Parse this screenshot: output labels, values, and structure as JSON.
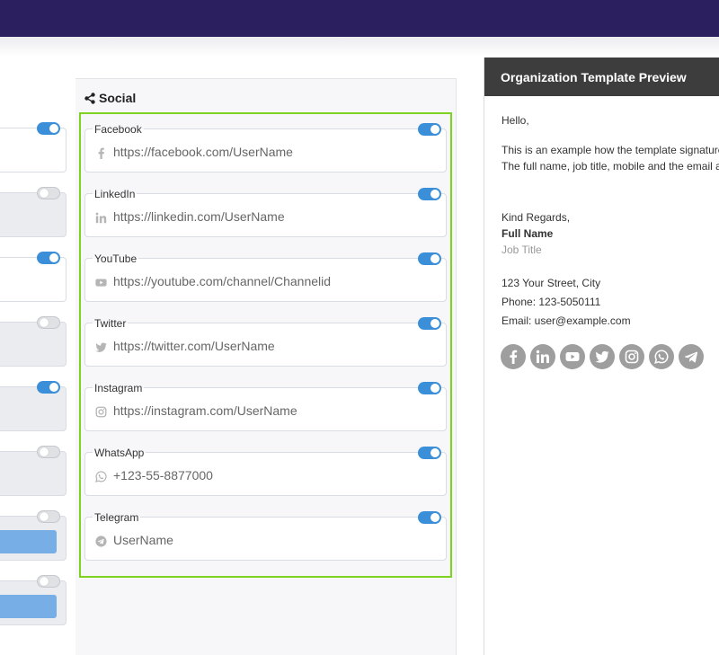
{
  "social": {
    "heading": "Social",
    "fields": [
      {
        "label": "Facebook",
        "value": "https://facebook.com/UserName",
        "icon": "facebook-icon",
        "enabled": true
      },
      {
        "label": "LinkedIn",
        "value": "https://linkedin.com/UserName",
        "icon": "linkedin-icon",
        "enabled": true
      },
      {
        "label": "YouTube",
        "value": "https://youtube.com/channel/Channelid",
        "icon": "youtube-icon",
        "enabled": true
      },
      {
        "label": "Twitter",
        "value": "https://twitter.com/UserName",
        "icon": "twitter-icon",
        "enabled": true
      },
      {
        "label": "Instagram",
        "value": "https://instagram.com/UserName",
        "icon": "instagram-icon",
        "enabled": true
      },
      {
        "label": "WhatsApp",
        "value": "+123-55-8877000",
        "icon": "whatsapp-icon",
        "enabled": true
      },
      {
        "label": "Telegram",
        "value": "UserName",
        "icon": "telegram-icon",
        "enabled": true
      }
    ]
  },
  "left_toggles": [
    true,
    false,
    true,
    false,
    true,
    false,
    false,
    false
  ],
  "preview": {
    "title": "Organization Template Preview",
    "greeting": "Hello,",
    "body_line1": "This is an example how the template signature",
    "body_line2": "The full name, job title, mobile and the email a",
    "regards": "Kind Regards,",
    "full_name": "Full Name",
    "job_title": "Job Title",
    "address": "123 Your Street, City",
    "phone": "Phone: 123-5050111",
    "email": "Email: user@example.com",
    "social_icons": [
      "facebook-icon",
      "linkedin-icon",
      "youtube-icon",
      "twitter-icon",
      "instagram-icon",
      "whatsapp-icon",
      "telegram-icon"
    ]
  },
  "colors": {
    "topbar": "#2b1f5f",
    "toggle_on": "#3b8fd8",
    "highlight": "#7ed321",
    "preview_header": "#3d3d3d"
  }
}
